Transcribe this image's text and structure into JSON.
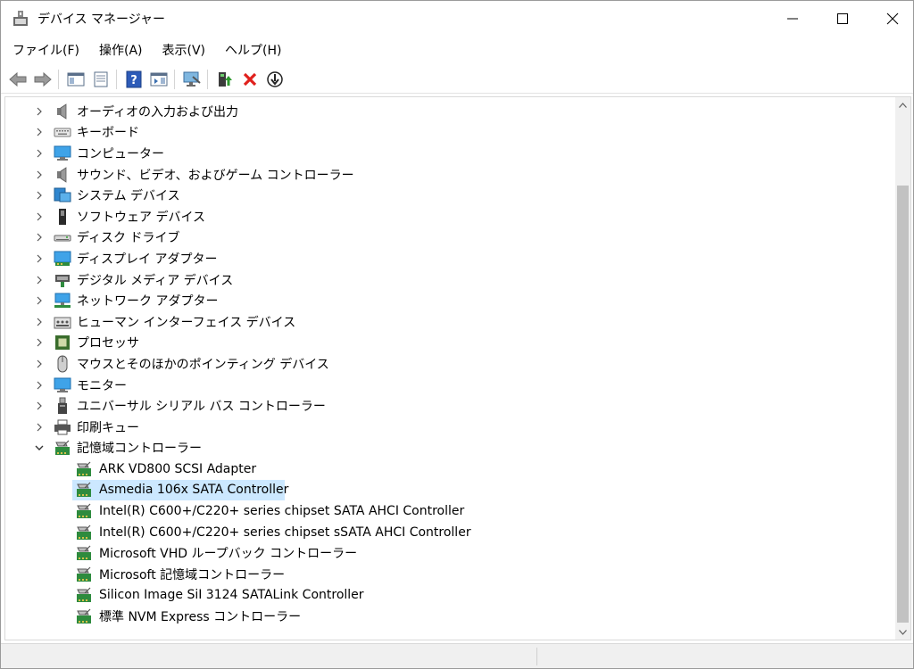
{
  "window": {
    "title": "デバイス マネージャー",
    "icon": "device-manager-icon"
  },
  "controls": {
    "minimize_icon": "minimize-icon",
    "maximize_icon": "maximize-icon",
    "close_icon": "close-icon"
  },
  "menu": [
    {
      "label": "ファイル(F)"
    },
    {
      "label": "操作(A)"
    },
    {
      "label": "表示(V)"
    },
    {
      "label": "ヘルプ(H)"
    }
  ],
  "toolbar": [
    {
      "icon": "back-arrow-icon"
    },
    {
      "icon": "forward-arrow-icon"
    },
    {
      "icon": "show-hide-console-tree-icon"
    },
    {
      "icon": "properties-icon"
    },
    {
      "icon": "help-icon"
    },
    {
      "icon": "action-pane-icon"
    },
    {
      "icon": "scan-hardware-icon"
    },
    {
      "icon": "update-driver-icon"
    },
    {
      "icon": "uninstall-device-icon"
    },
    {
      "icon": "disable-device-icon"
    }
  ],
  "tree": {
    "categories": [
      {
        "label": "オーディオの入力および出力",
        "icon": "speaker-icon",
        "expanded": false
      },
      {
        "label": "キーボード",
        "icon": "keyboard-icon",
        "expanded": false
      },
      {
        "label": "コンピューター",
        "icon": "computer-icon",
        "expanded": false
      },
      {
        "label": "サウンド、ビデオ、およびゲーム コントローラー",
        "icon": "sound-icon",
        "expanded": false
      },
      {
        "label": "システム デバイス",
        "icon": "system-device-icon",
        "expanded": false
      },
      {
        "label": "ソフトウェア デバイス",
        "icon": "software-device-icon",
        "expanded": false
      },
      {
        "label": "ディスク ドライブ",
        "icon": "disk-drive-icon",
        "expanded": false
      },
      {
        "label": "ディスプレイ アダプター",
        "icon": "display-adapter-icon",
        "expanded": false
      },
      {
        "label": "デジタル メディア デバイス",
        "icon": "digital-media-icon",
        "expanded": false
      },
      {
        "label": "ネットワーク アダプター",
        "icon": "network-adapter-icon",
        "expanded": false
      },
      {
        "label": "ヒューマン インターフェイス デバイス",
        "icon": "hid-icon",
        "expanded": false
      },
      {
        "label": "プロセッサ",
        "icon": "processor-icon",
        "expanded": false
      },
      {
        "label": "マウスとそのほかのポインティング デバイス",
        "icon": "mouse-icon",
        "expanded": false
      },
      {
        "label": "モニター",
        "icon": "monitor-icon",
        "expanded": false
      },
      {
        "label": "ユニバーサル シリアル バス コントローラー",
        "icon": "usb-icon",
        "expanded": false
      },
      {
        "label": "印刷キュー",
        "icon": "printer-icon",
        "expanded": false
      },
      {
        "label": "記憶域コントローラー",
        "icon": "storage-controller-icon",
        "expanded": true
      }
    ],
    "children": [
      {
        "label": "ARK VD800 SCSI Adapter",
        "selected": false
      },
      {
        "label": "Asmedia 106x SATA Controller",
        "selected": true
      },
      {
        "label": "Intel(R) C600+/C220+ series chipset SATA AHCI Controller",
        "selected": false
      },
      {
        "label": "Intel(R) C600+/C220+ series chipset sSATA AHCI Controller",
        "selected": false
      },
      {
        "label": "Microsoft VHD ループバック コントローラー",
        "selected": false
      },
      {
        "label": "Microsoft 記憶域コントローラー",
        "selected": false
      },
      {
        "label": "Silicon Image SiI 3124 SATALink Controller",
        "selected": false
      },
      {
        "label": "標準 NVM Express コントローラー",
        "selected": false
      }
    ]
  },
  "colors": {
    "selection": "#cce8ff",
    "scrollbar_thumb": "#c2c2c2"
  }
}
